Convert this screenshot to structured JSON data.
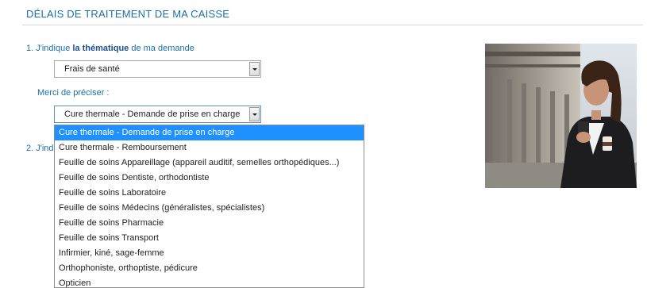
{
  "page": {
    "title": "DÉLAIS DE TRAITEMENT DE MA CAISSE"
  },
  "step1": {
    "prefix": "1. J'indique ",
    "emphasis": "la thématique",
    "suffix": " de ma demande"
  },
  "thematique_select": {
    "value": "Frais de santé"
  },
  "precision": {
    "label": "Merci de préciser :",
    "value": "Cure thermale - Demande de prise en charge"
  },
  "step2": {
    "label": "2. J'ind"
  },
  "dropdown": {
    "options": [
      "Cure thermale - Demande de prise en charge",
      "Cure thermale - Remboursement",
      "Feuille de soins Appareillage (appareil auditif, semelles orthopédiques...)",
      "Feuille de soins Dentiste, orthodontiste",
      "Feuille de soins Laboratoire",
      "Feuille de soins Médecins (généralistes, spécialistes)",
      "Feuille de soins Pharmacie",
      "Feuille de soins Transport",
      "Infirmier, kiné, sage-femme",
      "Orthophoniste, orthoptiste, pédicure",
      "Opticien"
    ],
    "selected_index": 0
  },
  "colors": {
    "heading_blue": "#1b6fa8",
    "selected_bg": "#1e90ff"
  }
}
